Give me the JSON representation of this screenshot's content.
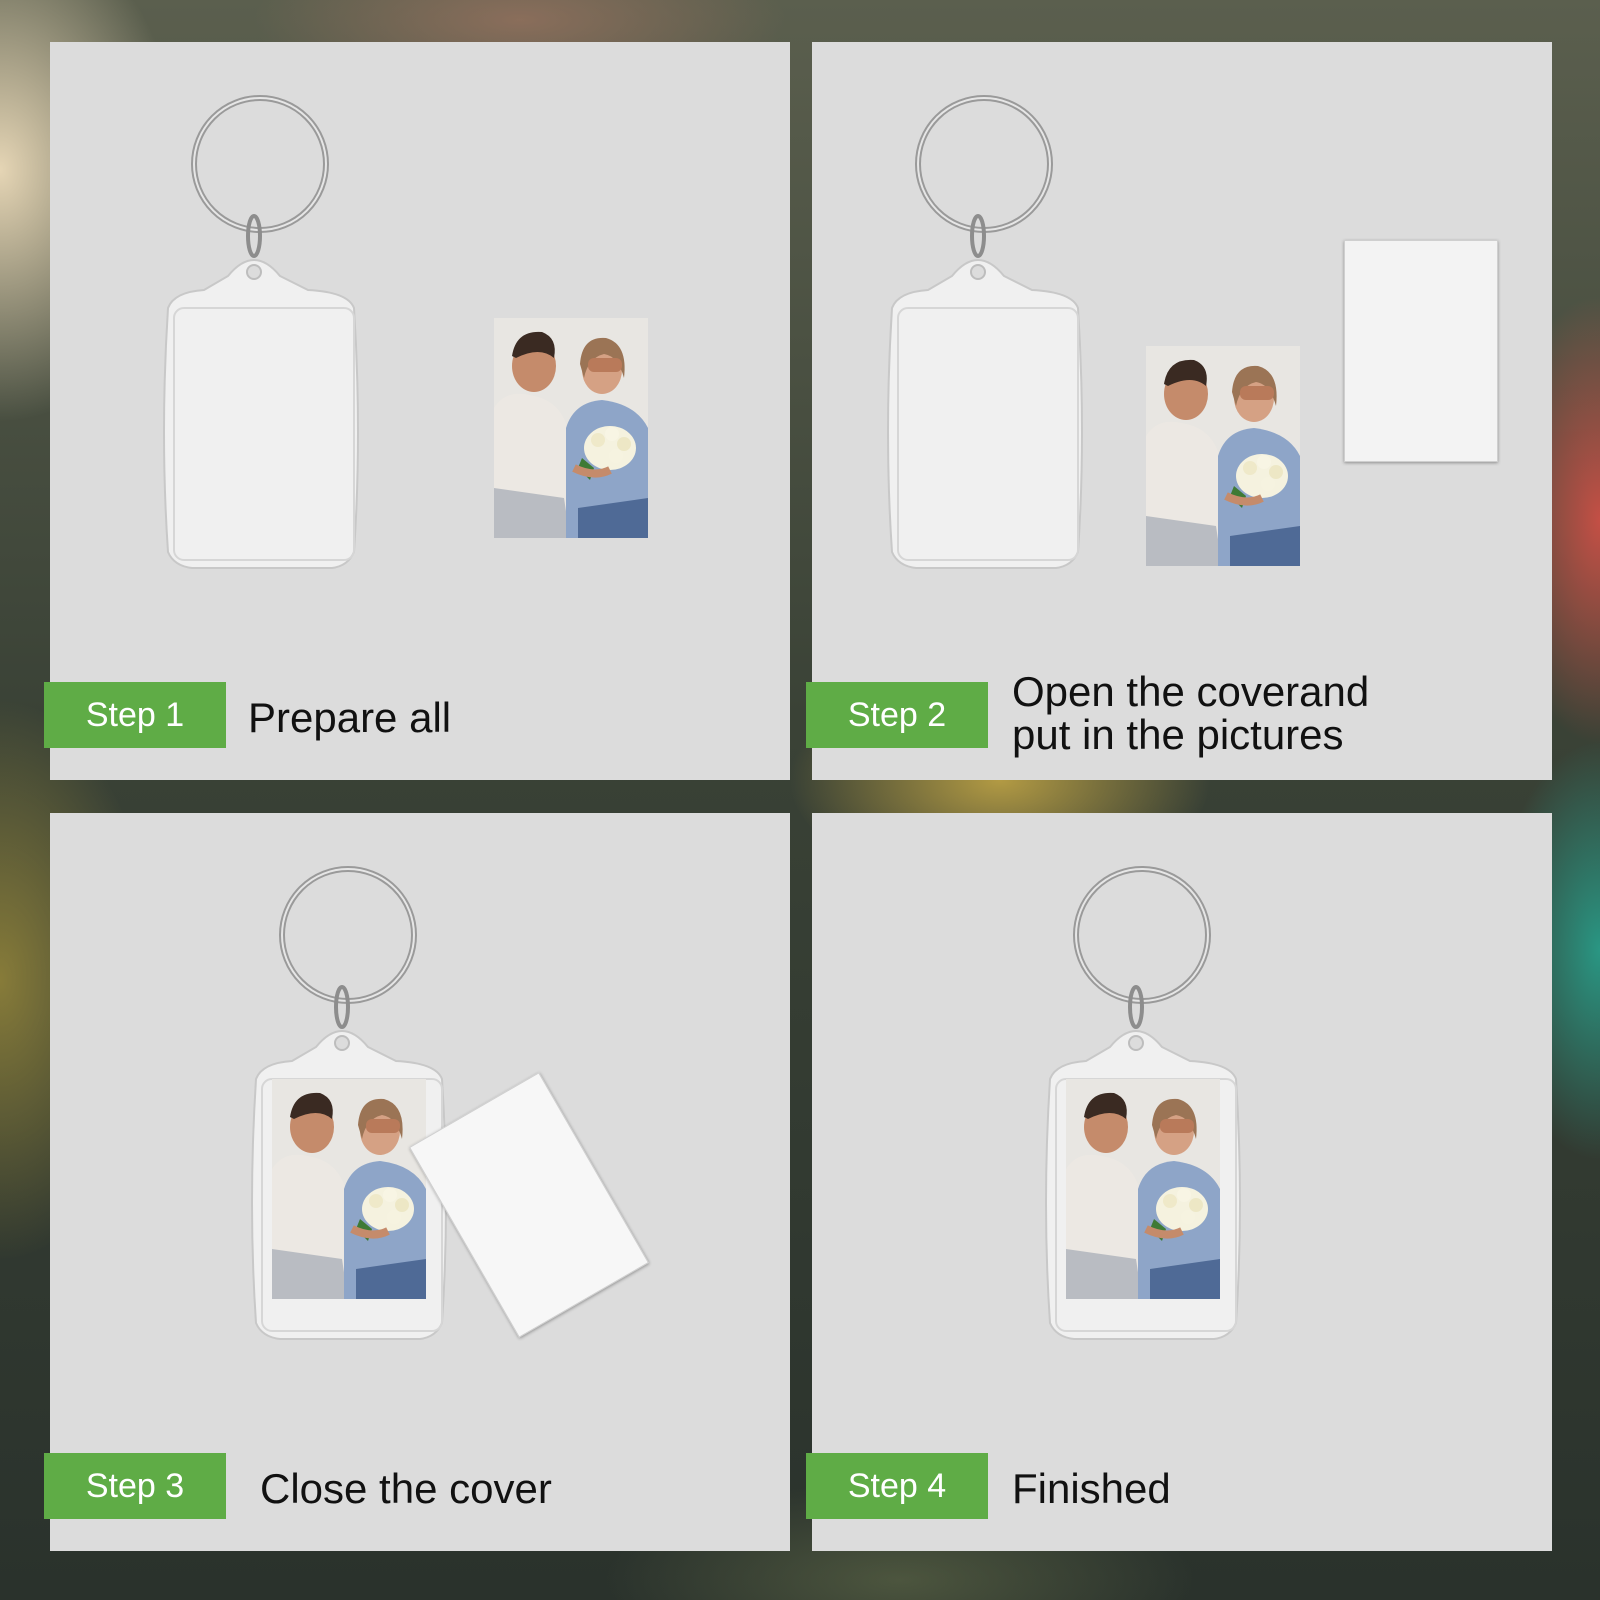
{
  "steps": [
    {
      "badge": "Step 1",
      "caption_lines": [
        "Prepare all"
      ]
    },
    {
      "badge": "Step 2",
      "caption_lines": [
        "Open the coverand",
        "put in the pictures"
      ]
    },
    {
      "badge": "Step 3",
      "caption_lines": [
        "Close the cover"
      ]
    },
    {
      "badge": "Step 4",
      "caption_lines": [
        "Finished"
      ]
    }
  ],
  "colors": {
    "badge_green": "#5fac46",
    "panel_gray": "#dcdcdc",
    "text_dark": "#111111"
  },
  "icons": [
    "keyring-icon",
    "acrylic-frame-icon",
    "couple-photo-icon",
    "paper-insert-icon"
  ]
}
